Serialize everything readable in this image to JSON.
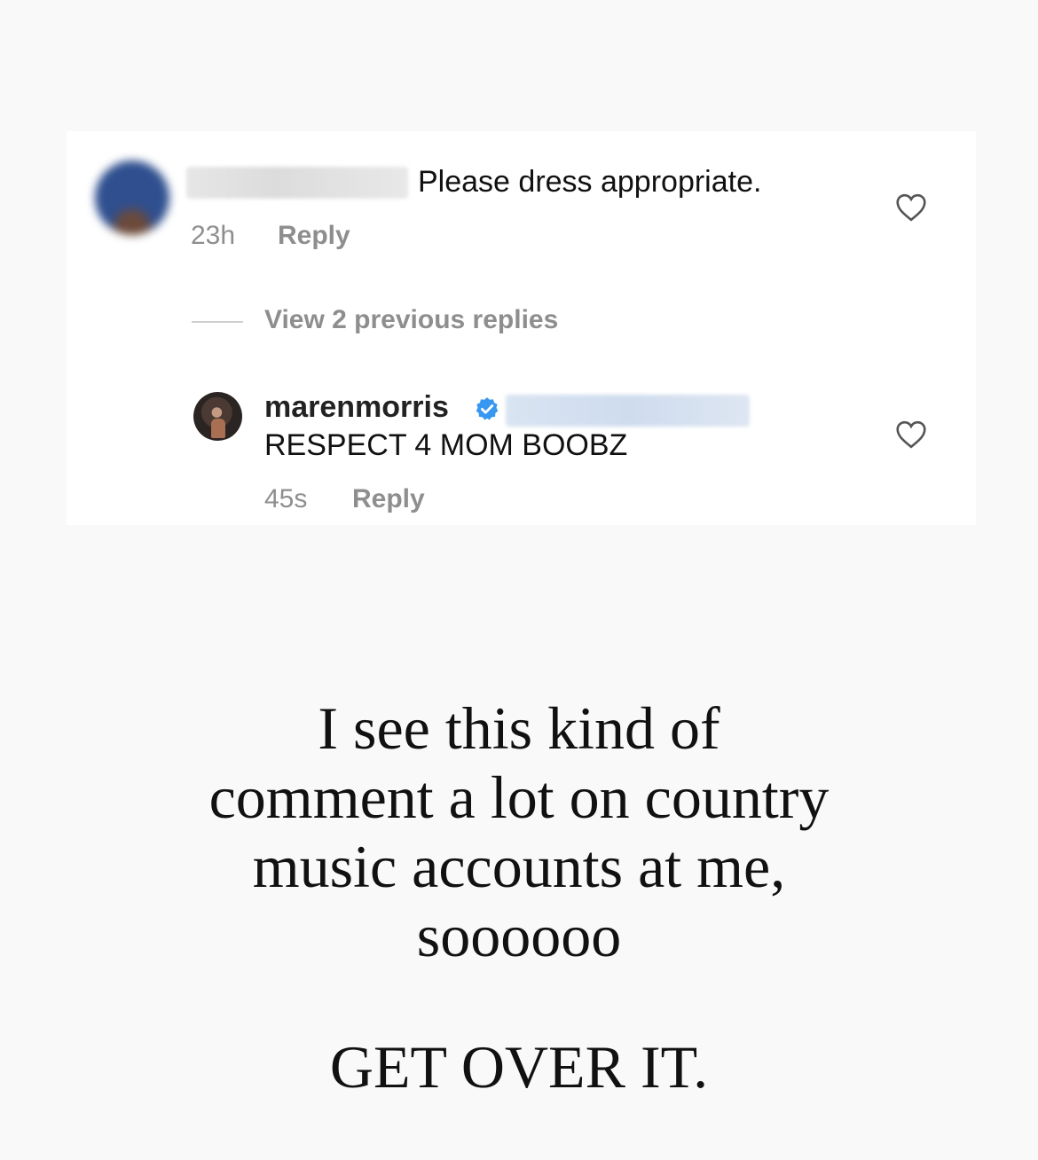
{
  "comment": {
    "text": "Please dress appropriate.",
    "time": "23h",
    "reply_label": "Reply"
  },
  "replies_toggle": {
    "label": "View 2 previous replies"
  },
  "reply": {
    "username": "marenmorris",
    "verified": true,
    "text": "RESPECT 4 MOM BOOBZ",
    "time": "45s",
    "reply_label": "Reply"
  },
  "caption": {
    "lines": [
      "I see this kind of",
      "comment a lot on country",
      "music accounts at me,",
      "soooooo"
    ],
    "closing": "GET OVER IT."
  },
  "colors": {
    "verified_badge": "#3897f0",
    "meta_text": "#8e8e8e"
  }
}
